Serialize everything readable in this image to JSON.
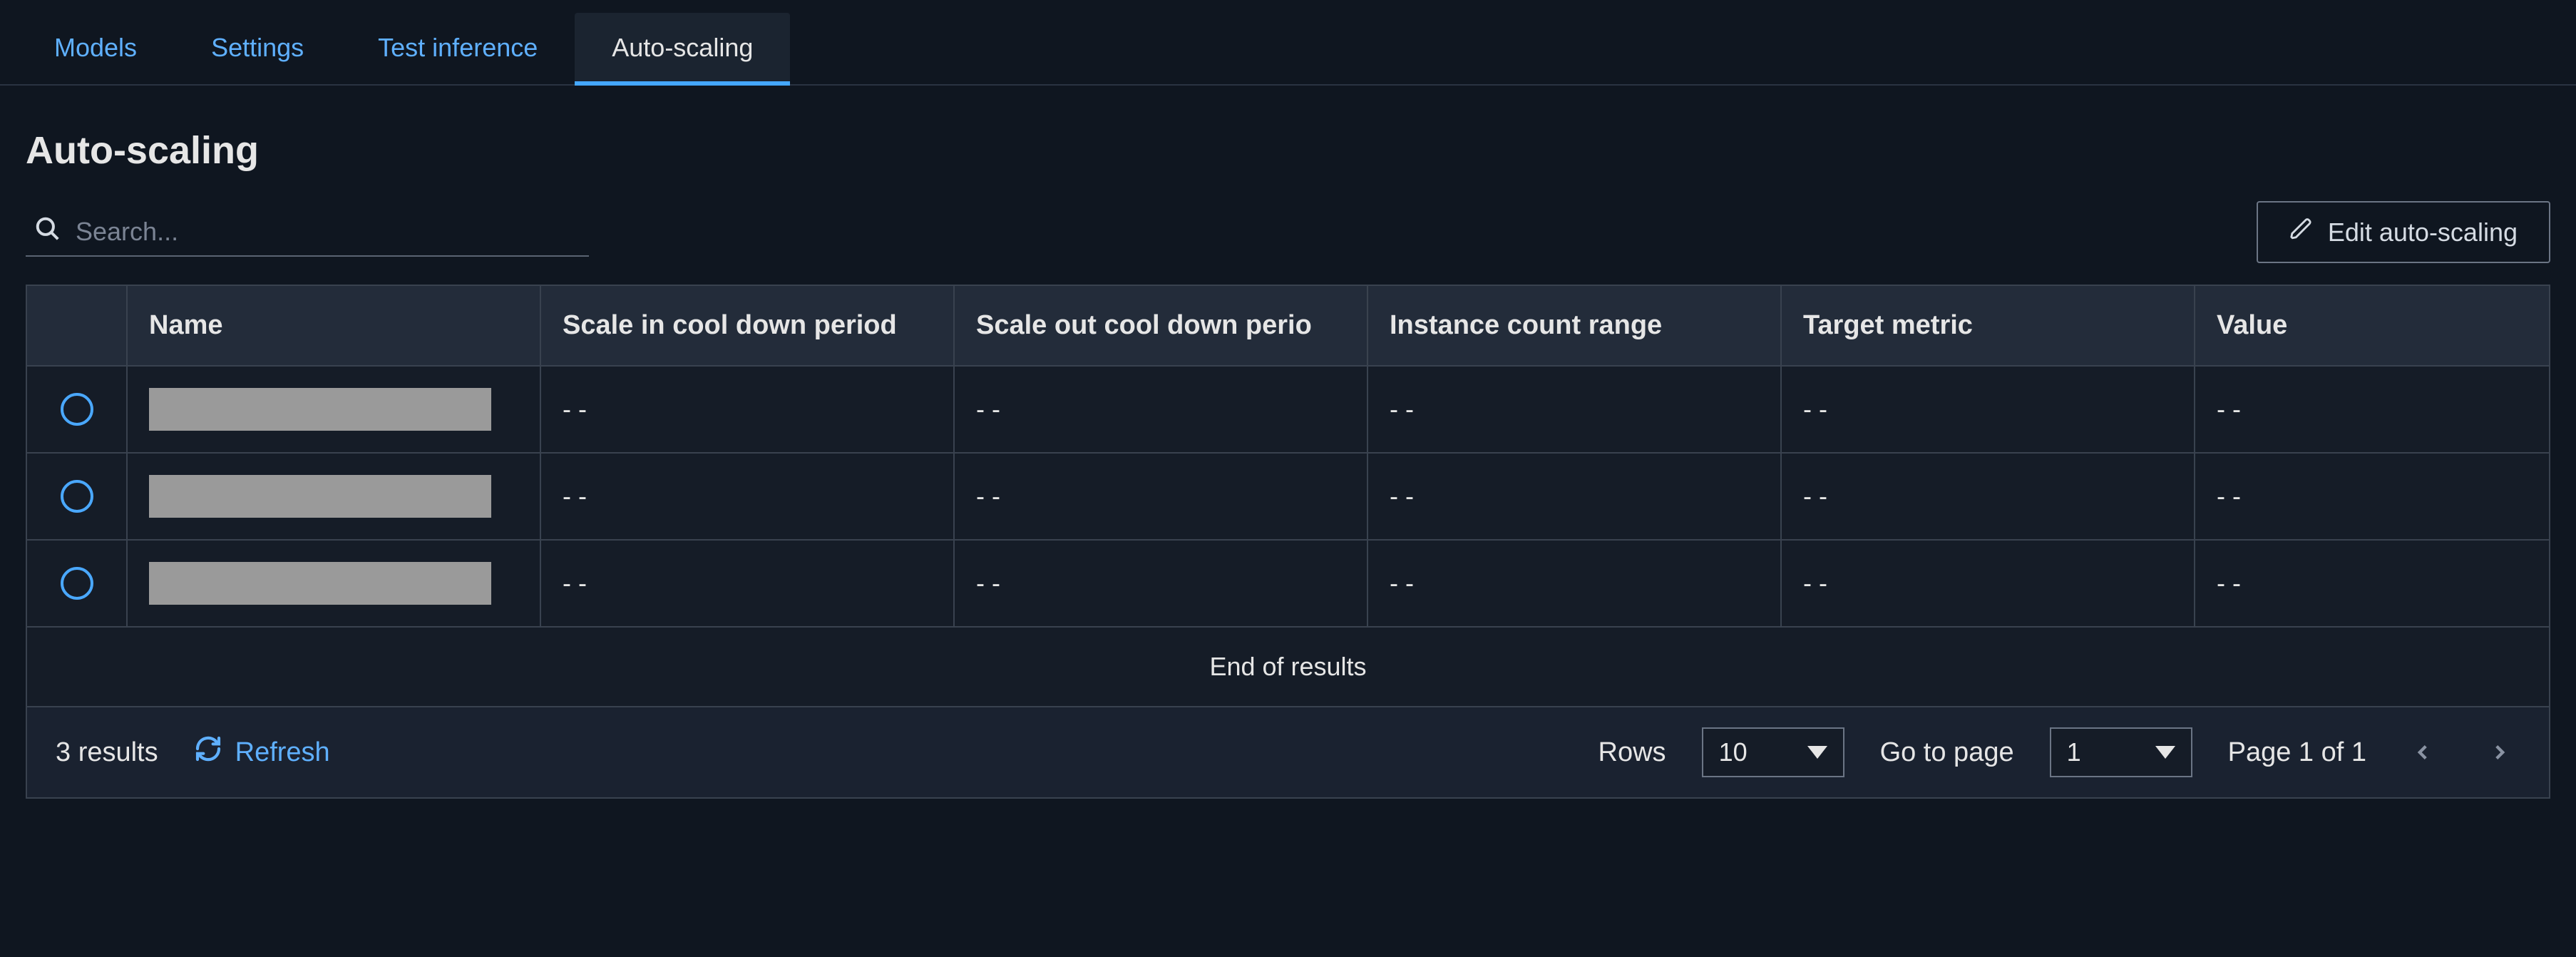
{
  "tabs": [
    {
      "label": "Models",
      "active": false
    },
    {
      "label": "Settings",
      "active": false
    },
    {
      "label": "Test inference",
      "active": false
    },
    {
      "label": "Auto-scaling",
      "active": true
    }
  ],
  "page_title": "Auto-scaling",
  "search": {
    "placeholder": "Search..."
  },
  "edit_button": {
    "label": "Edit auto-scaling"
  },
  "table": {
    "columns": [
      "Name",
      "Scale in cool down period",
      "Scale out cool down perio",
      "Instance count range",
      "Target metric",
      "Value"
    ],
    "rows": [
      {
        "name": "",
        "scale_in": "- -",
        "scale_out": "- -",
        "range": "- -",
        "metric": "- -",
        "value": "- -"
      },
      {
        "name": "",
        "scale_in": "- -",
        "scale_out": "- -",
        "range": "- -",
        "metric": "- -",
        "value": "- -"
      },
      {
        "name": "",
        "scale_in": "- -",
        "scale_out": "- -",
        "range": "- -",
        "metric": "- -",
        "value": "- -"
      }
    ],
    "end_text": "End of results"
  },
  "footer": {
    "results": "3 results",
    "refresh": "Refresh",
    "rows_label": "Rows",
    "rows_value": "10",
    "goto_label": "Go to page",
    "goto_value": "1",
    "page_status": "Page 1 of 1"
  }
}
